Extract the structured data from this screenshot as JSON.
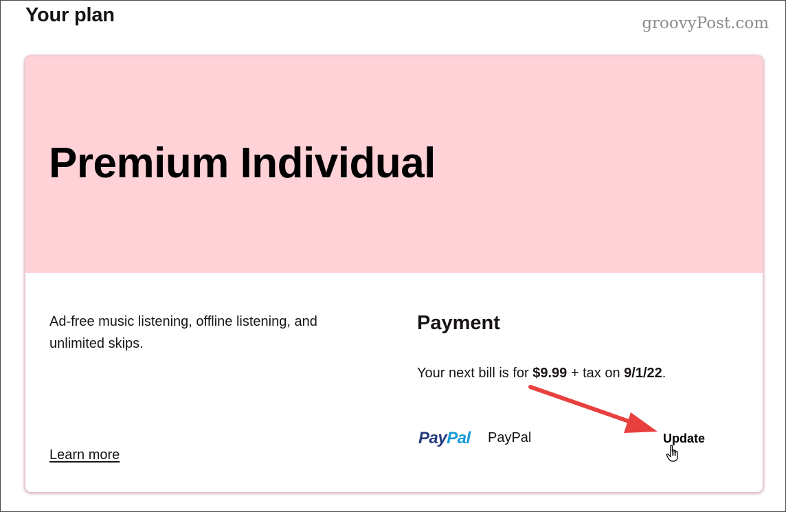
{
  "page": {
    "title": "Your plan"
  },
  "watermark": {
    "text": "groovyPost.com"
  },
  "plan": {
    "name": "Premium Individual",
    "description": "Ad-free music listening, offline listening, and unlimited skips.",
    "learn_more_label": "Learn more",
    "header_color": "#ffd2d7"
  },
  "payment": {
    "heading": "Payment",
    "bill_prefix": "Your next bill is for ",
    "amount": "$9.99",
    "bill_middle": " + tax on ",
    "date": "9/1/22",
    "bill_suffix": ".",
    "logo_part1": "Pay",
    "logo_part2": "Pal",
    "method_name": "PayPal",
    "update_label": "Update"
  },
  "annotation": {
    "arrow_color": "#e8403f",
    "cursor_icon": "hand-pointer-icon"
  }
}
